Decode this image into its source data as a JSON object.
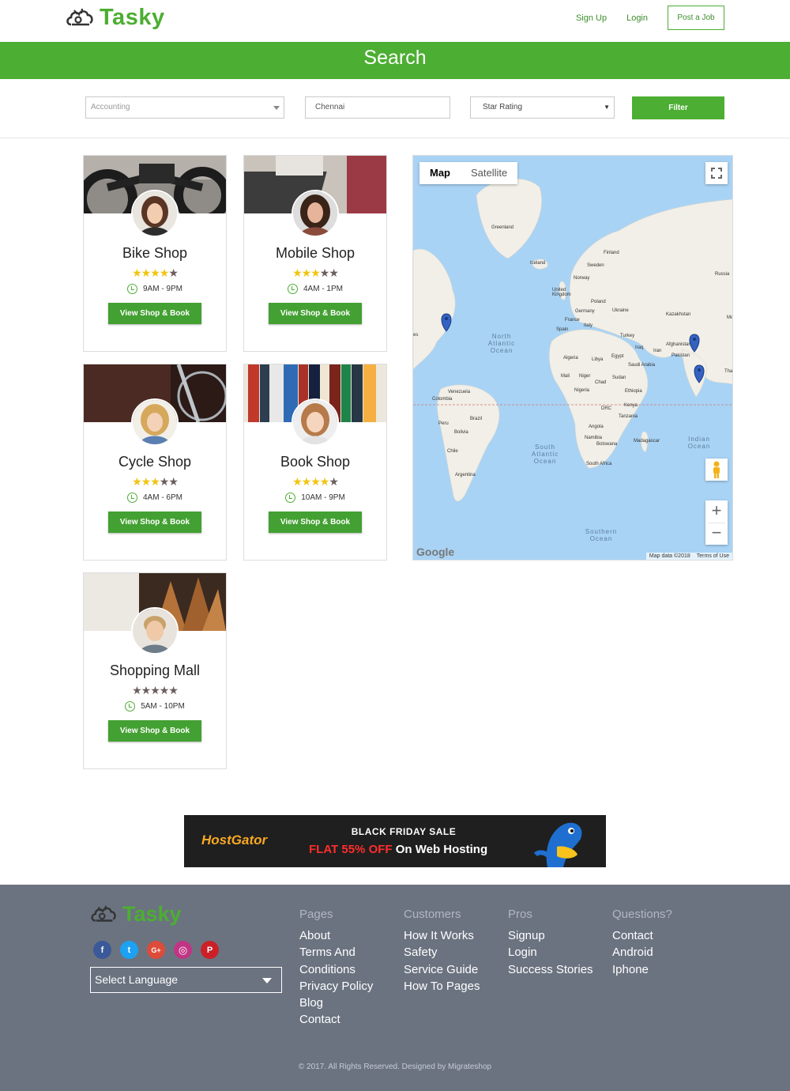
{
  "header": {
    "logo_text": "Tasky",
    "nav": {
      "signup": "Sign Up",
      "login": "Login",
      "post_job": "Post a Job"
    }
  },
  "banner": {
    "title": "Search"
  },
  "filters": {
    "category": "Accounting",
    "location": "Chennai",
    "rating": "Star Rating",
    "filter_button": "Filter"
  },
  "shops": [
    {
      "name": "Bike Shop",
      "rating": 4,
      "hours": "9AM - 9PM",
      "button": "View Shop & Book"
    },
    {
      "name": "Mobile Shop",
      "rating": 3,
      "hours": "4AM - 1PM",
      "button": "View Shop & Book"
    },
    {
      "name": "Cycle Shop",
      "rating": 3,
      "hours": "4AM - 6PM",
      "button": "View Shop & Book"
    },
    {
      "name": "Book Shop",
      "rating": 4,
      "hours": "10AM - 9PM",
      "button": "View Shop & Book"
    },
    {
      "name": "Shopping Mall",
      "rating": 0,
      "hours": "5AM - 10PM",
      "button": "View Shop & Book"
    }
  ],
  "map": {
    "tabs": {
      "map": "Map",
      "satellite": "Satellite"
    },
    "labels": {
      "greenland": "Greenland",
      "iceland": "Iceland",
      "finland": "Finland",
      "sweden": "Sweden",
      "norway": "Norway",
      "russia": "Russia",
      "uk": "United Kingdom",
      "poland": "Poland",
      "germany": "Germany",
      "ukraine": "Ukraine",
      "kazakhstan": "Kazakhstan",
      "france": "France",
      "italy": "Italy",
      "spain": "Spain",
      "turkey": "Turkey",
      "iraq": "Iraq",
      "iran": "Iran",
      "afghanistan": "Afghanistan",
      "pakistan": "Pakistan",
      "algeria": "Algeria",
      "libya": "Libya",
      "egypt": "Egypt",
      "saudi": "Saudi Arabia",
      "mali": "Mali",
      "niger": "Niger",
      "chad": "Chad",
      "sudan": "Sudan",
      "nigeria": "Nigeria",
      "ethiopia": "Ethiopia",
      "kenya": "Kenya",
      "drc": "DRC",
      "tanzania": "Tanzania",
      "angola": "Angola",
      "namibia": "Namibia",
      "botswana": "Botswana",
      "madagascar": "Madagascar",
      "south_africa": "South Africa",
      "venezuela": "Venezuela",
      "colombia": "Colombia",
      "peru": "Peru",
      "brazil": "Brazil",
      "bolivia": "Bolivia",
      "chile": "Chile",
      "argentina": "Argentina",
      "mo": "Mo",
      "tha": "Tha",
      "es": "es"
    },
    "oceans": {
      "north_atlantic": "North Atlantic Ocean",
      "south_atlantic": "South Atlantic Ocean",
      "indian": "Indian Ocean",
      "southern": "Southern Ocean"
    },
    "google": "Google",
    "map_data": "Map data ©2018",
    "terms": "Terms of Use"
  },
  "ad": {
    "brand": "HostGator",
    "line1": "BLACK FRIDAY SALE",
    "line2_red": "FLAT 55% OFF",
    "line2_white": "On Web Hosting"
  },
  "footer": {
    "logo_text": "Tasky",
    "social": {
      "facebook": "f",
      "twitter": "t",
      "google": "G+",
      "instagram": "◎",
      "pinterest": "P"
    },
    "language": "Select Language",
    "columns": [
      {
        "heading": "Pages",
        "items": [
          "About",
          "Terms And",
          "Conditions",
          "Privacy Policy",
          "Blog",
          "Contact"
        ]
      },
      {
        "heading": "Customers",
        "items": [
          "How It Works",
          "Safety",
          "Service Guide",
          "How To Pages"
        ]
      },
      {
        "heading": "Pros",
        "items": [
          "Signup",
          "Login",
          "Success Stories"
        ]
      },
      {
        "heading": "Questions?",
        "items": [
          "Contact",
          "Android",
          "Iphone"
        ]
      }
    ],
    "copyright": "© 2017. All Rights Reserved. Designed by Migrateshop"
  },
  "colors": {
    "brand_green": "#4cae32",
    "footer_bg": "#6b7380",
    "map_water": "#a9d3f5",
    "map_land": "#f1efe7"
  }
}
